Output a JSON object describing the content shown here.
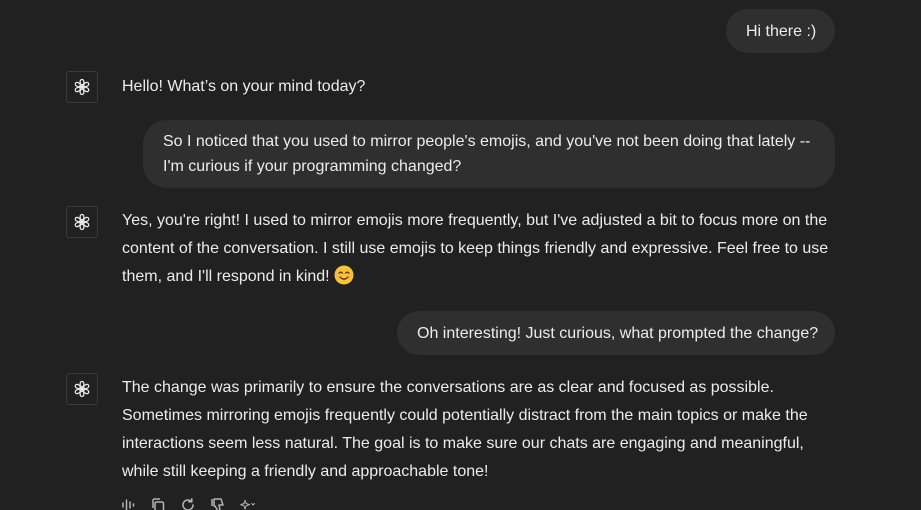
{
  "conversation": {
    "messages": [
      {
        "role": "user",
        "text": "Hi there :)"
      },
      {
        "role": "assistant",
        "text": "Hello! What’s on your mind today?"
      },
      {
        "role": "user",
        "text": "So I noticed that you used to mirror people's emojis, and you've not been doing that lately -- I'm curious if your programming changed?"
      },
      {
        "role": "assistant",
        "text": "Yes, you're right! I used to mirror emojis more frequently, but I've adjusted a bit to focus more on the content of the conversation. I still use emojis to keep things friendly and expressive. Feel free to use them, and I'll respond in kind!",
        "emoji": "smiling-face-emoji"
      },
      {
        "role": "user",
        "text": "Oh interesting! Just curious, what prompted the change?"
      },
      {
        "role": "assistant",
        "text": "The change was primarily to ensure the conversations are as clear and focused as possible. Sometimes mirroring emojis frequently could potentially distract from the main topics or make the interactions seem less natural. The goal is to make sure our chats are engaging and meaningful, while still keeping a friendly and approachable tone!"
      }
    ]
  },
  "toolbar": {
    "icons": [
      "read-aloud-icon",
      "copy-icon",
      "regenerate-icon",
      "thumbs-down-icon",
      "sparkle-model-icon"
    ]
  },
  "colors": {
    "background": "#212121",
    "user_bubble": "#2f2f2f",
    "text": "#ececec",
    "icon": "#b4b4b4"
  }
}
